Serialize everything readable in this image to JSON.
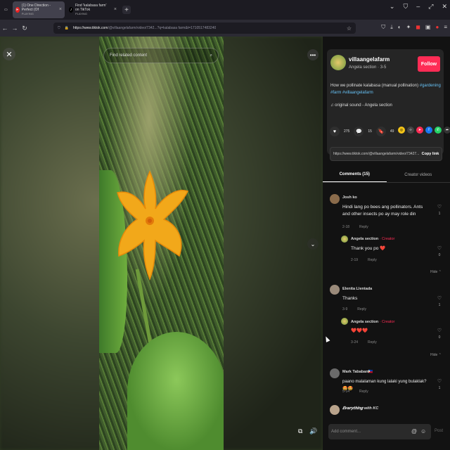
{
  "browser": {
    "tabs": [
      {
        "title": "(1) One Direction - Perfect (Of",
        "subtitle": "PLAYING",
        "active": true
      },
      {
        "title": "Find 'kalabasa farm' on TikTok",
        "subtitle": "PLAYING",
        "active": false
      }
    ],
    "url_host": "https://www.tiktok.com",
    "url_path": "/@villaangelafarm/video/7342...?q=kalabasa farm&t=1710517483240"
  },
  "video": {
    "search_placeholder": "Find related content"
  },
  "post": {
    "username": "villaangelafarm",
    "subline": "Angela section · 3-5",
    "follow_label": "Follow",
    "description": "How we pollinate kalabasa (manual pollination) ",
    "tags": "#gardening #farm #villaangelafarm",
    "sound": "original sound - Angela section",
    "likes": "275",
    "comments": "15",
    "saves": "49",
    "link": "https://www.tiktok.com/@villaangelafarm/video/73427...",
    "copy_label": "Copy link"
  },
  "tabs": {
    "comments": "Comments (15)",
    "creator": "Creator videos"
  },
  "comments": [
    {
      "name": "Josh ko",
      "text": "Hindi lang po bees ang pollinators. Ants and other insects po ay may role din",
      "date": "2-18",
      "reply": "Reply",
      "likes": "1"
    },
    {
      "name": "Angela section",
      "creator": "· Creator",
      "text": "Thank you po ❤️",
      "date": "2-19",
      "reply": "Reply",
      "likes": "0"
    },
    {
      "name": "Elenita Llentada",
      "text": "Thanks",
      "date": "3-9",
      "reply": "Reply",
      "likes": "1"
    },
    {
      "name": "Angela section",
      "creator": "· Creator",
      "text": "❤️❤️❤️",
      "date": "3-24",
      "reply": "Reply",
      "likes": "0"
    },
    {
      "name": "Mark Tababan🇵🇭",
      "text": "paano malalaman kung lalaki yung bulaklak? 🤩🤩",
      "date": "5-14",
      "reply": "Reply",
      "likes": "1"
    },
    {
      "name": "𝑬𝒗𝒆𝒓𝒚𝒕𝒉𝒊𝒏𝒈 with KC",
      "text": "",
      "date": "",
      "reply": "",
      "likes": ""
    }
  ],
  "hide_label": "Hide",
  "add_comment_placeholder": "Add comment...",
  "post_label": "Post",
  "colors": {
    "accent": "#fe2c55",
    "tag": "#67c1f5",
    "panel": "#121212"
  }
}
